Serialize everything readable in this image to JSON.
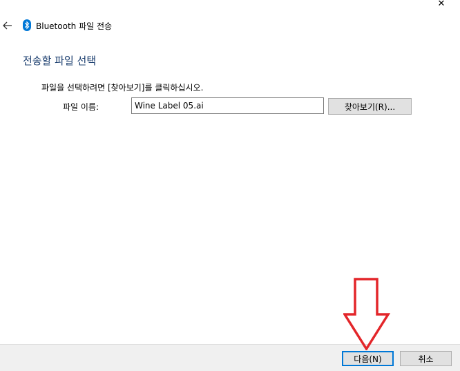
{
  "window": {
    "title": "Bluetooth 파일 전송",
    "close_glyph": "✕",
    "back_glyph": "←"
  },
  "page": {
    "heading": "전송할 파일 선택",
    "instruction": "파일을 선택하려면 [찾아보기]를 클릭하십시오."
  },
  "file": {
    "label": "파일 이름:",
    "value": "Wine Label 05.ai"
  },
  "buttons": {
    "browse": "찾아보기(R)...",
    "next": "다음(N)",
    "cancel": "취소"
  },
  "colors": {
    "heading": "#1a3d6e",
    "bluetooth": "#0078d7",
    "annotation_arrow": "#e3262a"
  },
  "icons": {
    "bluetooth": "bluetooth-icon",
    "back": "back-arrow-icon",
    "close": "close-icon",
    "annotation": "red-down-arrow-annotation"
  }
}
